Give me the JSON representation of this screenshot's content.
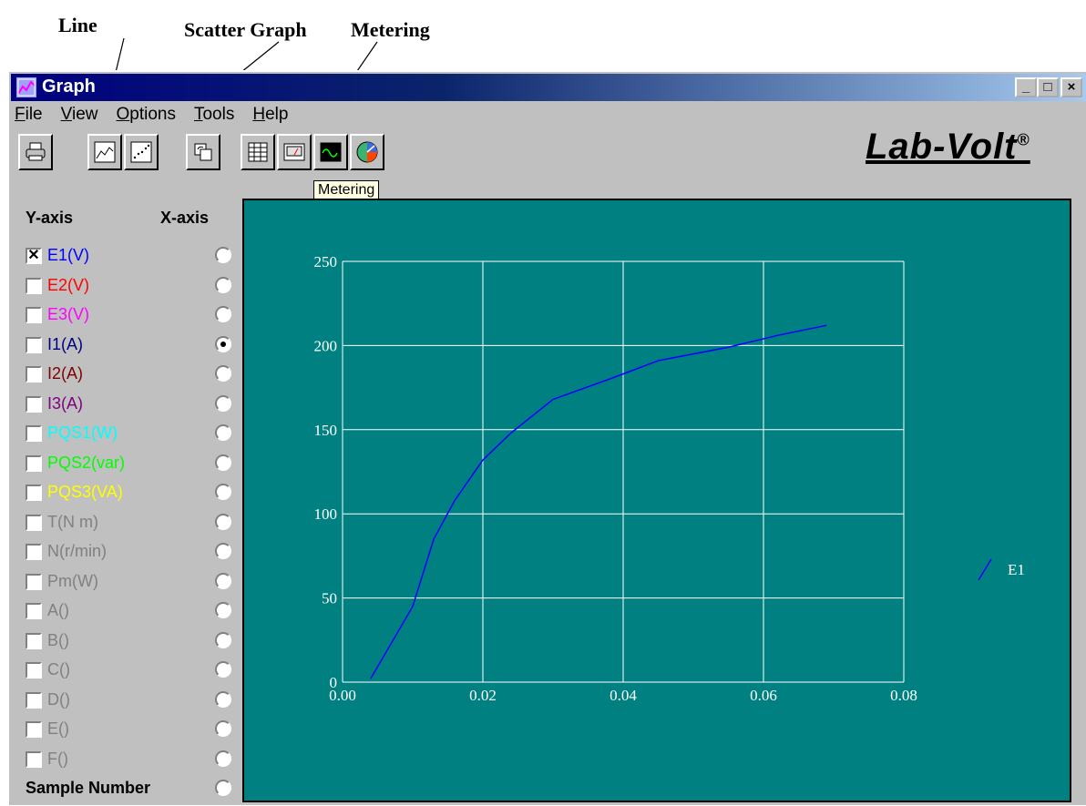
{
  "callouts": {
    "line": "Line",
    "scatter": "Scatter Graph",
    "metering": "Metering"
  },
  "window": {
    "title": "Graph",
    "minimize": "_",
    "maximize": "□",
    "close": "×"
  },
  "menu": [
    {
      "label": "File",
      "accel": "F",
      "rest": "ile"
    },
    {
      "label": "View",
      "accel": "V",
      "rest": "iew"
    },
    {
      "label": "Options",
      "accel": "O",
      "rest": "ptions"
    },
    {
      "label": "Tools",
      "accel": "T",
      "rest": "ools"
    },
    {
      "label": "Help",
      "accel": "H",
      "rest": "elp"
    }
  ],
  "toolbar": {
    "buttons": [
      "print-icon",
      "line-graph-icon",
      "scatter-graph-icon",
      "refresh-icon",
      "table-icon",
      "meter-icon",
      "metering-icon",
      "phasor-icon"
    ],
    "tooltip": "Metering"
  },
  "logo": {
    "text": "Lab-Volt",
    "mark": "®"
  },
  "panel": {
    "y_header": "Y-axis",
    "x_header": "X-axis",
    "rows": [
      {
        "label": "E1(V)",
        "color": "#0000ff",
        "checked": true,
        "x_selected": false
      },
      {
        "label": "E2(V)",
        "color": "#ff0000",
        "checked": false,
        "x_selected": false
      },
      {
        "label": "E3(V)",
        "color": "#ff00ff",
        "checked": false,
        "x_selected": false
      },
      {
        "label": "I1(A)",
        "color": "#000080",
        "checked": false,
        "x_selected": true
      },
      {
        "label": "I2(A)",
        "color": "#800000",
        "checked": false,
        "x_selected": false
      },
      {
        "label": "I3(A)",
        "color": "#800080",
        "checked": false,
        "x_selected": false
      },
      {
        "label": "PQS1(W)",
        "color": "#00ffff",
        "checked": false,
        "x_selected": false
      },
      {
        "label": "PQS2(var)",
        "color": "#00ff00",
        "checked": false,
        "x_selected": false
      },
      {
        "label": "PQS3(VA)",
        "color": "#ffff00",
        "checked": false,
        "x_selected": false
      },
      {
        "label": "T(N m)",
        "color": "#808080",
        "checked": false,
        "x_selected": false
      },
      {
        "label": "N(r/min)",
        "color": "#808080",
        "checked": false,
        "x_selected": false
      },
      {
        "label": "Pm(W)",
        "color": "#808080",
        "checked": false,
        "x_selected": false
      },
      {
        "label": "A()",
        "color": "#808080",
        "checked": false,
        "x_selected": false
      },
      {
        "label": "B()",
        "color": "#808080",
        "checked": false,
        "x_selected": false
      },
      {
        "label": "C()",
        "color": "#808080",
        "checked": false,
        "x_selected": false
      },
      {
        "label": "D()",
        "color": "#808080",
        "checked": false,
        "x_selected": false
      },
      {
        "label": "E()",
        "color": "#808080",
        "checked": false,
        "x_selected": false
      },
      {
        "label": "F()",
        "color": "#808080",
        "checked": false,
        "x_selected": false
      }
    ],
    "sample_number": "Sample Number",
    "check_mark": "✕"
  },
  "chart_data": {
    "type": "line",
    "title": "",
    "xlabel": "",
    "ylabel": "",
    "xlim": [
      0,
      0.08
    ],
    "ylim": [
      0,
      250
    ],
    "x_ticks": [
      "0.00",
      "0.02",
      "0.04",
      "0.06",
      "0.08"
    ],
    "y_ticks": [
      "0",
      "50",
      "100",
      "150",
      "200",
      "250"
    ],
    "grid": true,
    "background": "#008080",
    "legend_position": "right",
    "series": [
      {
        "name": "E1",
        "color": "#0000ff",
        "x": [
          0.004,
          0.01,
          0.013,
          0.016,
          0.02,
          0.024,
          0.03,
          0.038,
          0.045,
          0.055,
          0.062,
          0.069
        ],
        "y": [
          2,
          45,
          85,
          108,
          132,
          148,
          168,
          180,
          191,
          199,
          206,
          212
        ]
      }
    ]
  }
}
